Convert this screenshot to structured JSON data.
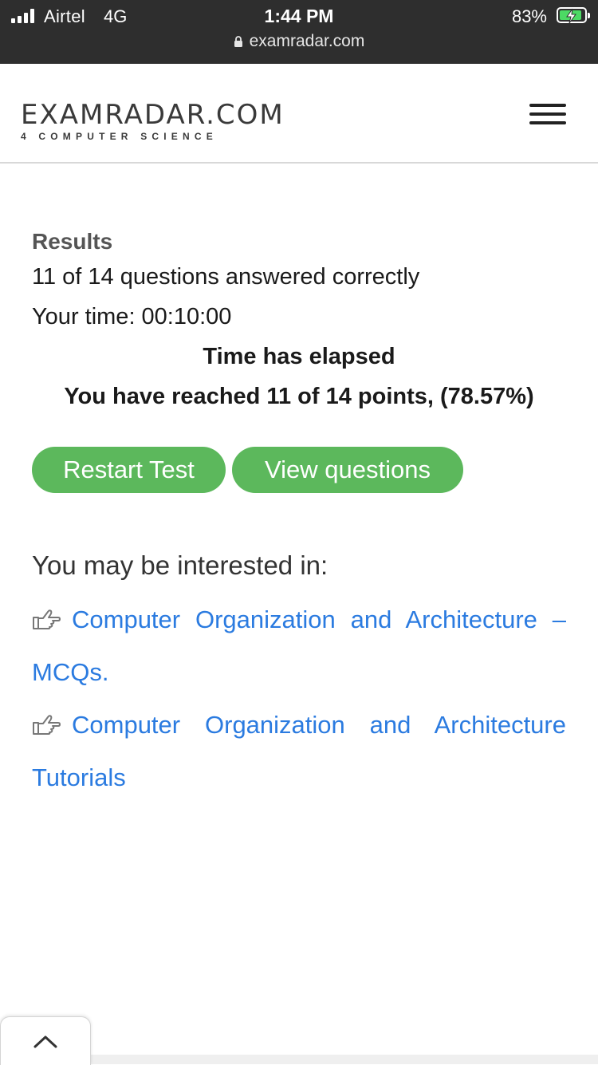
{
  "status_bar": {
    "carrier": "Airtel",
    "network": "4G",
    "time": "1:44 PM",
    "battery_percent": "83%",
    "url": "examradar.com"
  },
  "header": {
    "logo_title": "EXAMRADAR.COM",
    "logo_subtitle": "4 COMPUTER SCIENCE"
  },
  "results": {
    "heading": "Results",
    "answered": "11 of 14 questions answered correctly",
    "time": "Your time: 00:10:00",
    "elapsed": "Time has elapsed",
    "points": "You have reached 11 of 14 points, (78.57%)"
  },
  "buttons": {
    "restart": "Restart Test",
    "view": "View questions"
  },
  "interest": {
    "title": "You may be interested in:",
    "link1_main": "Computer Organization and Architecture –",
    "link1_tail": "MCQs.",
    "link2_main": "Computer Organization and Architecture",
    "link2_tail": "Tutorials"
  },
  "colors": {
    "accent_green": "#5cb85c",
    "link_blue": "#2b7be0",
    "status_bar": "#2e2e2e"
  },
  "icons": [
    "signal-icon",
    "battery-icon",
    "lock-icon",
    "hamburger-menu-icon",
    "pointing-hand-icon",
    "chevron-up-icon"
  ]
}
